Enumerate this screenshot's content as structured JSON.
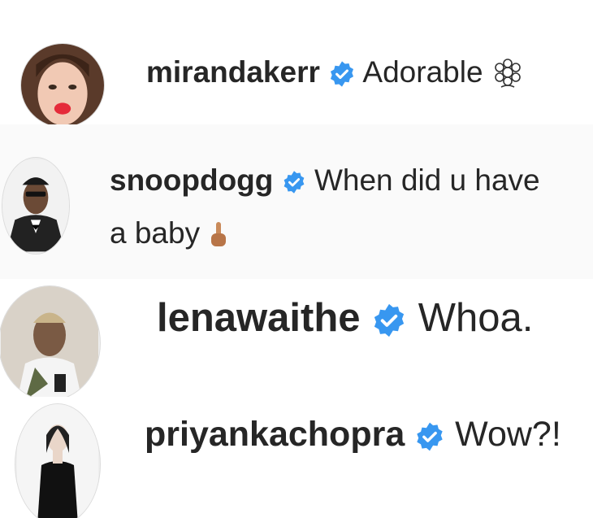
{
  "comments": [
    {
      "username": "mirandakerr",
      "text": "Adorable",
      "emoji": "flower-emoji-icon"
    },
    {
      "username": "snoopdogg",
      "text_line1": "When did u have",
      "text_line2": "a baby",
      "emoji": "pointing-up-emoji-icon"
    },
    {
      "username": "lenawaithe",
      "text": "Whoa."
    },
    {
      "username": "priyankachopra",
      "text": "Wow?!"
    }
  ],
  "colors": {
    "verified_badge": "#3897f0",
    "text": "#262626",
    "accent_edge": "#e8583c"
  }
}
